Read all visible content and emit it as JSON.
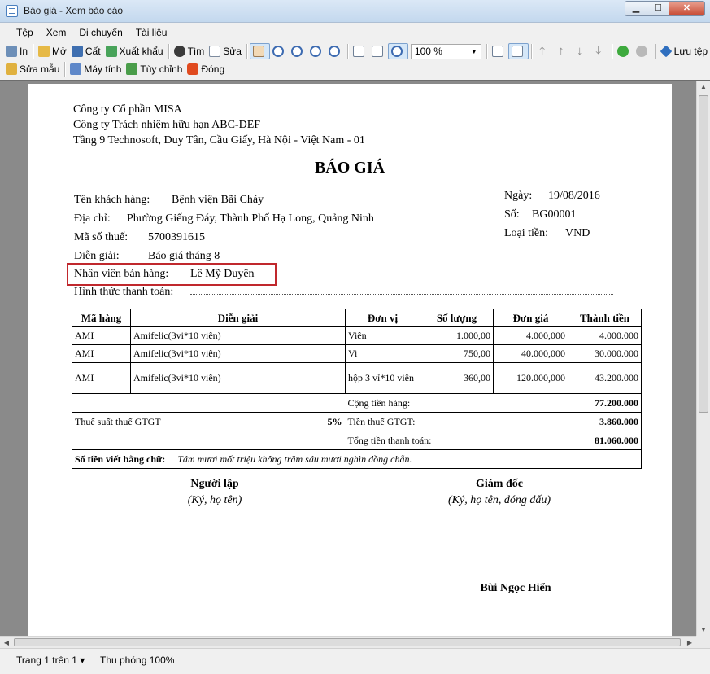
{
  "window": {
    "title": "Báo giá - Xem báo cáo",
    "minimize": "▁",
    "maximize": "☐",
    "close": "✕"
  },
  "menu": [
    "Tệp",
    "Xem",
    "Di chuyển",
    "Tài liệu"
  ],
  "toolbar": {
    "print": "In",
    "open": "Mở",
    "save": "Cất",
    "export": "Xuất khẩu",
    "find": "Tìm",
    "edit": "Sửa",
    "zoom_value": "100 %",
    "save_file": "Lưu tệp",
    "edit_template": "Sửa mẫu",
    "calculator": "Máy tính",
    "customize": "Tùy chỉnh",
    "close": "Đóng"
  },
  "document": {
    "company": "Công ty Cổ phần MISA",
    "branch": "Công ty Trách nhiệm hữu hạn ABC-DEF",
    "address": "Tầng 9 Technosoft, Duy Tân, Cầu Giấy, Hà Nội - Việt Nam - 01",
    "title": "BÁO GIÁ",
    "customer_label": "Tên khách hàng:",
    "customer": "Bệnh viện Bãi Cháy",
    "address_label": "Địa chỉ:",
    "customer_address": "Phường Giếng Đáy, Thành Phố Hạ Long, Quảng Ninh",
    "tax_label": "Mã số thuế:",
    "tax_code": "5700391615",
    "desc_label": "Diễn giải:",
    "description": "Báo giá tháng 8",
    "staff_label": "Nhân viên bán hàng:",
    "staff": "Lê Mỹ Duyên",
    "payment_label": "Hình thức thanh toán:",
    "date_label": "Ngày:",
    "date": "19/08/2016",
    "number_label": "Số:",
    "number": "BG00001",
    "currency_label": "Loại tiền:",
    "currency": "VND"
  },
  "table": {
    "headers": [
      "Mã hàng",
      "Diễn giải",
      "Đơn vị",
      "Số lượng",
      "Đơn giá",
      "Thành tiền"
    ],
    "rows": [
      [
        "AMI",
        "Amifelic(3vi*10 viên)",
        "Viên",
        "1.000,00",
        "4.000,000",
        "4.000.000"
      ],
      [
        "AMI",
        "Amifelic(3vi*10 viên)",
        "Vi",
        "750,00",
        "40.000,000",
        "30.000.000"
      ],
      [
        "AMI",
        "Amifelic(3vi*10 viên)",
        "hộp 3 vỉ*10 viên",
        "360,00",
        "120.000,000",
        "43.200.000"
      ]
    ],
    "subtotal_label": "Cộng tiền hàng:",
    "subtotal": "77.200.000",
    "vat_rate_label": "Thuế suất thuế GTGT",
    "vat_rate": "5%",
    "vat_label": "Tiền thuế GTGT:",
    "vat": "3.860.000",
    "total_label": "Tổng tiền thanh toán:",
    "total": "81.060.000",
    "words_label": "Số tiền viết bằng chữ:",
    "words": "Tám mươi mốt triệu không trăm sáu mươi nghìn đồng chẵn."
  },
  "signatures": {
    "creator_title": "Người lập",
    "creator_sub": "(Ký, họ tên)",
    "director_title": "Giám đốc",
    "director_sub": "(Ký, họ tên, đóng dấu)",
    "director_name": "Bùi Ngọc Hiển"
  },
  "status": {
    "page": "Trang 1 trên 1 ▾",
    "zoom": "Thu phóng 100%"
  }
}
